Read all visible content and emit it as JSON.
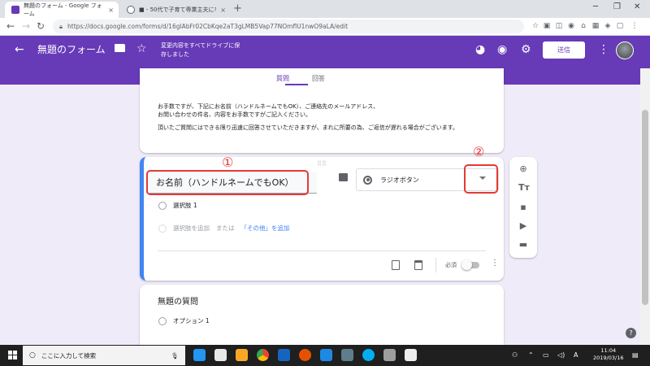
{
  "browser": {
    "tabs": [
      {
        "title": "無題のフォーム - Google フォーム",
        "close": "×"
      },
      {
        "title": "■ - 50代で子育て専業主夫になっ…",
        "close": "×"
      }
    ],
    "new_tab": "+",
    "window_controls": [
      "─",
      "❐",
      "✕"
    ],
    "url": "https://docs.google.com/forms/d/16glAbFr02CbKqe2aT3gLMB5Vap77NOmflU1nwO9aLA/edit"
  },
  "forms_header": {
    "title": "無題のフォーム",
    "saved_status": "変更内容をすべてドライブに保存しました",
    "send_label": "送信"
  },
  "editor_tabs": {
    "questions": "質問",
    "responses": "回答"
  },
  "description": [
    "お手数ですが、下記にお名前（ハンドルネームでもOK）、ご連絡先のメールアドレス、",
    "お問い合わせの件名、内容をお手数ですがご記入ください。",
    "頂いたご質問にはできる限り迅速に回答させていただきますが、まれに所要の為、ご返信が遅れる場合がございます。"
  ],
  "question1": {
    "title": "お名前（ハンドルネームでもOK）",
    "type": "ラジオボタン",
    "options": [
      "選択肢 1"
    ],
    "add_option": "選択肢を追加",
    "or": "または",
    "add_other": "「その他」を追加",
    "required_label": "必須",
    "required": false
  },
  "annotations": {
    "one": "①",
    "two": "②"
  },
  "question2": {
    "title": "無題の質問",
    "options": [
      "オプション 1"
    ]
  },
  "taskbar": {
    "search_placeholder": "ここに入力して検索",
    "time": "11:04",
    "date": "2019/03/16"
  },
  "colors": {
    "accent": "#673ab7",
    "annotation": "#e53935",
    "focus": "#4285f4"
  }
}
